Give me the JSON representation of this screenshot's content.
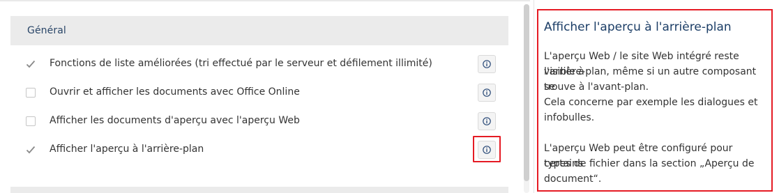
{
  "settings": {
    "section_title": "Général",
    "options": [
      {
        "label": "Fonctions de liste améliorées (tri effectué par le serveur et défilement illimité)",
        "checked": true
      },
      {
        "label": "Ouvrir et afficher les documents avec Office Online",
        "checked": false
      },
      {
        "label": "Afficher les documents d'aperçu avec l'aperçu Web",
        "checked": false
      },
      {
        "label": "Afficher l'aperçu à l'arrière-plan",
        "checked": true
      }
    ]
  },
  "help": {
    "title": "Afficher l'aperçu à l'arrière-plan",
    "paragraph1_lines": [
      "L'aperçu Web / le site Web intégré reste visible à",
      "l'arrière-plan, même si un autre composant se",
      "trouve à l'avant-plan.",
      "Cela concerne par exemple les dialogues et",
      "infobulles."
    ],
    "paragraph2_lines": [
      "L'aperçu Web peut être configuré pour certains",
      "types de fichier dans la section „Aperçu de",
      "document“."
    ]
  },
  "colors": {
    "accent_title": "#1b3d66",
    "highlight": "#e51b24",
    "header_bg": "#ebebeb"
  },
  "icons": {
    "info": "info-circle-icon",
    "check": "checkmark-icon"
  }
}
